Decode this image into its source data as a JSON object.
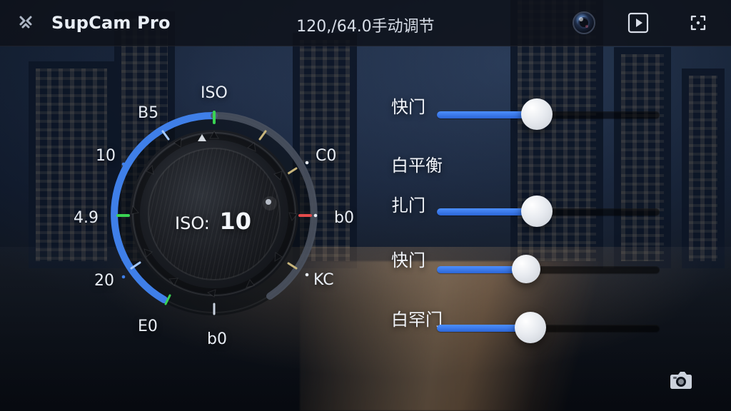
{
  "app": {
    "title": "SupCam Pro",
    "status": "120,/64.0手动调节"
  },
  "icons": {
    "brand": "x-brand-icon",
    "lens": "lens-icon",
    "play": "play-icon",
    "focus": "focus-grid-icon",
    "camera": "camera-icon"
  },
  "dial": {
    "labels": {
      "top": "ISO",
      "top_left": "B5",
      "left_upper": "10",
      "left": "4.9",
      "left_lower": "20",
      "bottom_left": "E0",
      "bottom": "b0",
      "right": "b0",
      "right_lower": "KC",
      "right_upper": "C0"
    },
    "readout_label": "ISO:",
    "readout_value": "10",
    "accent": "#3f7fe8",
    "active_green": "#39d353",
    "marker_red": "#e34b4b"
  },
  "controls": {
    "shutter_1": {
      "label": "快门",
      "level": 0.45
    },
    "white_balance": {
      "label": "白平衡"
    },
    "shutter_2": {
      "label": "扎门",
      "level": 0.45
    },
    "shutter_3": {
      "label": "快门",
      "level": 0.4
    },
    "shutter_4": {
      "label": "白罕门",
      "level": 0.42
    }
  }
}
